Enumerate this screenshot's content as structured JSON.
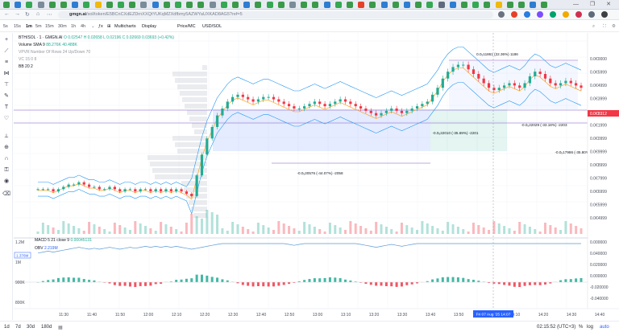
{
  "browser": {
    "url_host": "gmgn.ai",
    "url_path": "/sol/token/E5BCnCXdEZDrnXXQtYUKqMZXdfbmy5AZWYaUXKAD8AG5?ref=5"
  },
  "toolbar": {
    "timeframes": [
      "5s",
      "15s",
      "1m",
      "5m",
      "15m",
      "30m",
      "1h",
      "4h"
    ],
    "active_timeframe": "1m",
    "multicharts_label": "Multicharts",
    "display_label": "Display",
    "price_mc_label": "Price/MC",
    "usd_sol_label": "USD/SOL"
  },
  "chart_legend": {
    "pair": "BTH/SOL · 1 · GMGN.AI",
    "ohlc": "O 0.02547 H 0.02658 L 0.02196 C 0.02669 0.03693 (+0.42%)",
    "volume": "Volume SMA 9",
    "volume_values": "88.276K 40.488K",
    "vpvr": "VPVR Number Of Rows 24 Up/Down 70",
    "vc": "VC 15 0 8",
    "bb": "BB 20 2",
    "macd": "MACD 5 21 close 9",
    "macd_value": "0.00045131",
    "obv": "OBV",
    "obv_value": "2.219M"
  },
  "price_axis": {
    "ticks": [
      "0.0€0000",
      "0.0€5999",
      "0.0€4999",
      "0.0€3999",
      "0.0€2999",
      "0.0€1999",
      "0.0€0999",
      "0.0€9999",
      "0.0€8999",
      "0.0€7999",
      "0.0€6999",
      "0.0€5999",
      "0.0€4999"
    ],
    "current_price": "0.0€8312",
    "macd_ticks": [
      "0.000000",
      "0.040000",
      "0.020000",
      "0.000000",
      "-0.020000",
      "-0.040000"
    ]
  },
  "obv_axis": {
    "ticks": [
      "1.2M",
      "1M",
      "900K",
      "800K"
    ],
    "badge": "1.376M"
  },
  "time_axis": {
    "ticks": [
      "11:30",
      "11:40",
      "11:50",
      "12:00",
      "12:10",
      "12:20",
      "12:30",
      "12:40",
      "12:50",
      "13:00",
      "13:10",
      "13:20",
      "13:30",
      "13:40",
      "13:50",
      "14:00",
      "14:10",
      "14:20",
      "14:30",
      "14:40"
    ],
    "crosshair_label": "Fri 07 Aug '25   14:07"
  },
  "measurements": [
    "0.0₅11861 (22.36%) 1186",
    "-0.0₅20576 (-44.07%) -2058",
    "-0.0₅22010 (-35.69%) -2201",
    "-0.0₅22029 (-33.18%) -2203",
    "-0.0₅17986 (-35.80%) -1799"
  ],
  "bottom": {
    "ranges": [
      "1d",
      "7d",
      "30d",
      "180d"
    ],
    "clock": "02:15:52 (UTC+3)",
    "pct_label": "%",
    "log_label": "log",
    "auto_label": "auto"
  },
  "colors": {
    "up": "#22ab94",
    "down": "#f23645",
    "accent": "#2962ff",
    "bb": "#2196f3",
    "obv": "#5b9bd5",
    "ma": "#ff9800"
  },
  "chart_data": {
    "type": "candlestick",
    "title": "",
    "series": [
      {
        "name": "Price",
        "values": [
          0.0006,
          0.0006,
          0.0006,
          0.00059,
          0.0006,
          0.00061,
          0.00062,
          0.00062,
          0.00063,
          0.00062,
          0.00061,
          0.00061,
          0.0006,
          0.0006,
          0.00061,
          0.0006,
          0.00059,
          0.0006,
          0.0006,
          0.00059,
          0.0006,
          0.0006,
          0.00059,
          0.0006,
          0.00059,
          0.0006,
          0.00059,
          0.0006,
          0.00059,
          0.00058,
          0.00057,
          0.00066,
          0.00075,
          0.00082,
          0.00087,
          0.00092,
          0.00095,
          0.00098,
          0.001,
          0.00101,
          0.001,
          0.00099,
          0.00098,
          0.00099,
          0.001,
          0.001,
          0.00099,
          0.00098,
          0.00097,
          0.00096,
          0.00095,
          0.00095,
          0.00096,
          0.00097,
          0.00098,
          0.00097,
          0.00096,
          0.00097,
          0.00098,
          0.00099,
          0.00098,
          0.00097,
          0.00096,
          0.00095,
          0.00094,
          0.00093,
          0.00092,
          0.00093,
          0.00094,
          0.00095,
          0.00094,
          0.00093,
          0.00094,
          0.00095,
          0.00096,
          0.00097,
          0.00098,
          0.00101,
          0.00104,
          0.00108,
          0.00111,
          0.00113,
          0.00114,
          0.00114,
          0.00112,
          0.0011,
          0.00108,
          0.00106,
          0.00104,
          0.00103,
          0.00104,
          0.00105,
          0.00106,
          0.00105,
          0.00104,
          0.00106,
          0.00109,
          0.00111,
          0.0011,
          0.00108,
          0.00106,
          0.00105,
          0.00106,
          0.00107,
          0.00106,
          0.00105,
          0.00104
        ]
      },
      {
        "name": "MACD"
      },
      {
        "name": "OBV"
      }
    ]
  }
}
